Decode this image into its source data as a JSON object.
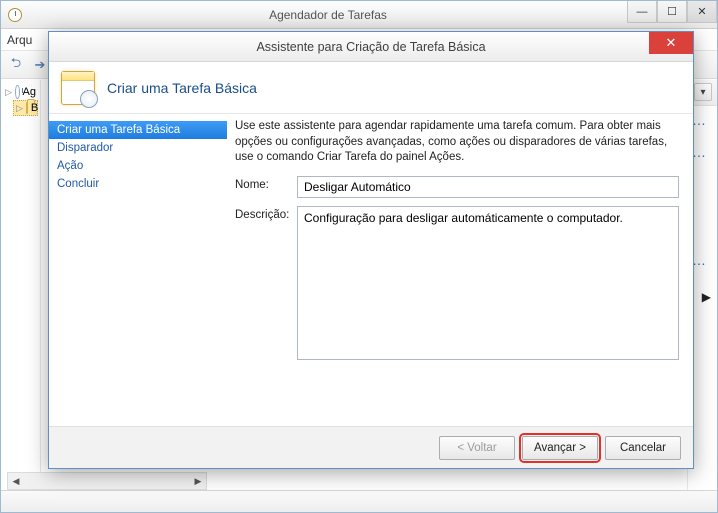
{
  "parent": {
    "title": "Agendador de Tarefas",
    "menu_file": "Arqu",
    "tree_root": "Ag",
    "tree_child": "B"
  },
  "dialog": {
    "title": "Assistente para Criação de Tarefa Básica",
    "header": "Criar uma Tarefa Básica",
    "steps": [
      "Criar uma Tarefa Básica",
      "Disparador",
      "Ação",
      "Concluir"
    ],
    "active_step_index": 0,
    "intro": "Use este assistente para agendar rapidamente uma tarefa comum. Para obter mais opções ou configurações avançadas, como ações ou disparadores de várias tarefas, use o comando Criar Tarefa do painel Ações.",
    "name_label": "Nome:",
    "name_value": "Desligar Automático",
    "desc_label": "Descrição:",
    "desc_value": "Configuração para desligar automáticamente o computador.",
    "buttons": {
      "back": "< Voltar",
      "next": "Avançar >",
      "cancel": "Cancelar"
    }
  }
}
